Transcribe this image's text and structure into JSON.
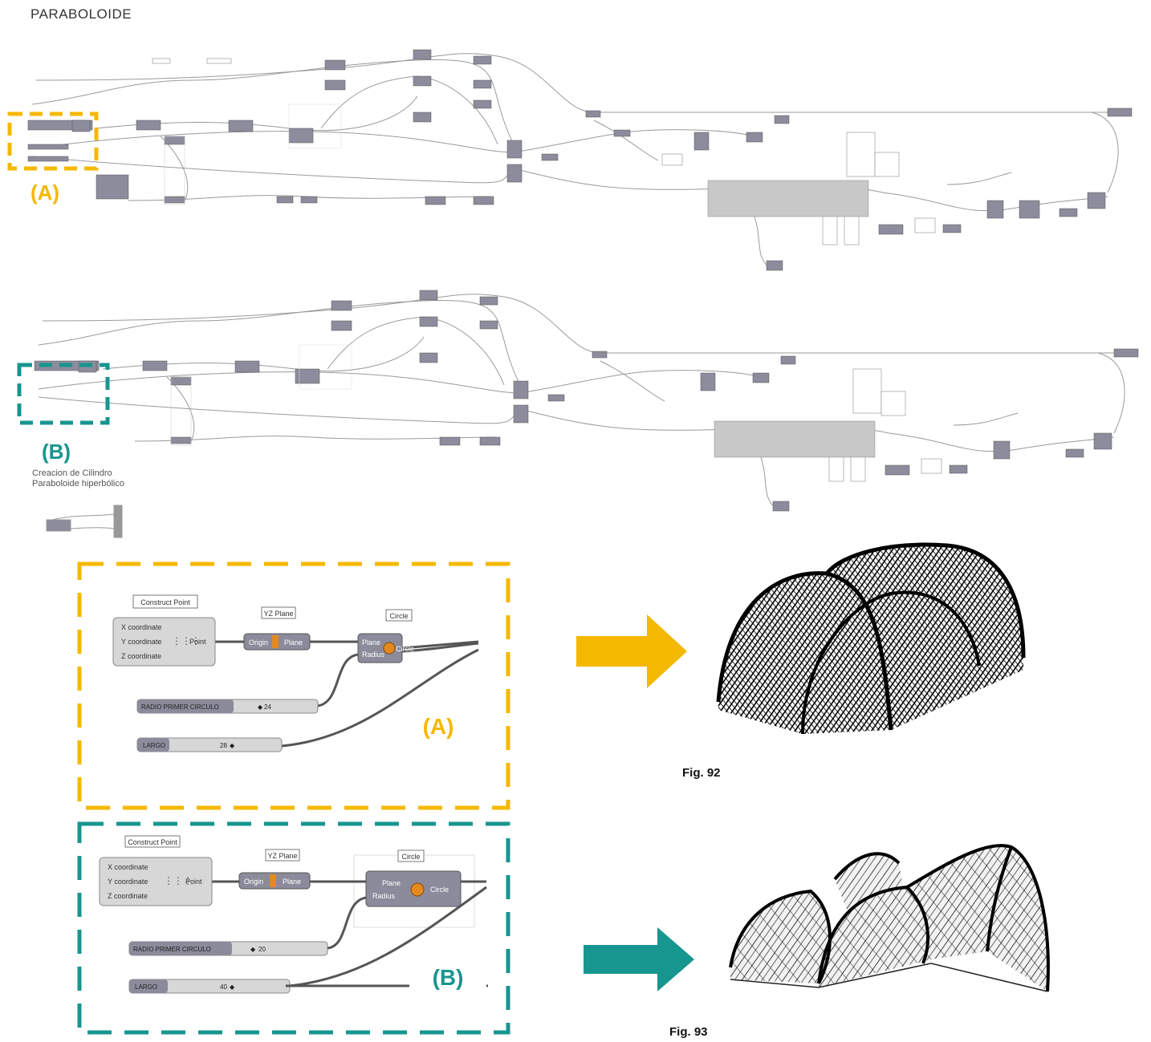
{
  "page_title": "PARABOLOIDE",
  "callouts": {
    "a_label": "(A)",
    "b_label": "(B)"
  },
  "overview_note": {
    "line1": "Creacion de Cilindro",
    "line2": "Paraboloide hiperbólico"
  },
  "detail_a": {
    "construct_point_title": "Construct Point",
    "x_input": "X coordinate",
    "y_input": "Y coordinate",
    "z_input": "Z coordinate",
    "point_output": "Point",
    "yz_plane_title": "YZ Plane",
    "origin_input": "Origin",
    "plane_output": "Plane",
    "circle_title": "Circle",
    "circle_plane_input": "Plane",
    "circle_radius_input": "Radius",
    "circle_output": "Circle",
    "slider1_name": "RADIO PRIMER CIRCULO",
    "slider1_value": "24",
    "slider2_name": "LARGO",
    "slider2_value": "28",
    "inner_label": "(A)"
  },
  "detail_b": {
    "construct_point_title": "Construct Point",
    "x_input": "X coordinate",
    "y_input": "Y coordinate",
    "z_input": "Z coordinate",
    "point_output": "Point",
    "yz_plane_title": "YZ Plane",
    "origin_input": "Origin",
    "plane_output": "Plane",
    "circle_title": "Circle",
    "circle_plane_input": "Plane",
    "circle_radius_input": "Radius",
    "circle_output": "Circle",
    "slider1_name": "RADIO PRIMER CIRCULO",
    "slider1_value": "20",
    "slider2_name": "LARGO",
    "slider2_value": "40",
    "inner_label": "(B)"
  },
  "figures": {
    "fig92": "Fig. 92",
    "fig93": "Fig. 93"
  },
  "colors": {
    "accent_a": "#f5b800",
    "accent_b": "#17968f",
    "node_gray": "#8a8a9a",
    "wire": "#7a7a7a"
  }
}
